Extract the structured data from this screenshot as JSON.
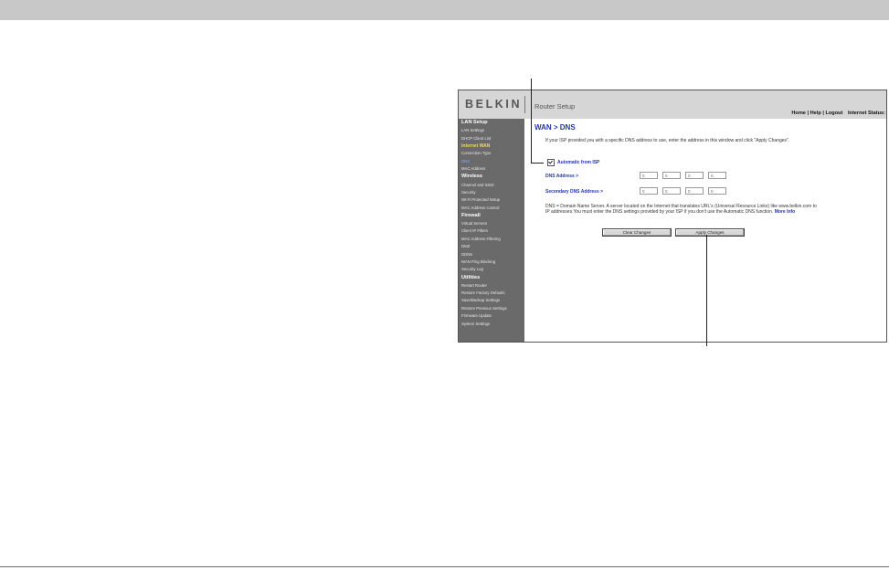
{
  "header": {
    "logo": "BELKIN",
    "title": "Router Setup",
    "links": [
      "Home",
      "Help",
      "Logout"
    ],
    "internet_status_label": "Internet Status:"
  },
  "sidebar": {
    "items": [
      {
        "label": "LAN Setup",
        "type": "heading"
      },
      {
        "label": "LAN Settings",
        "type": "link"
      },
      {
        "label": "DHCP Client List",
        "type": "link"
      },
      {
        "label": "Internet WAN",
        "type": "active-heading"
      },
      {
        "label": "Connection Type",
        "type": "link"
      },
      {
        "label": "DNS",
        "type": "current"
      },
      {
        "label": "MAC Address",
        "type": "link"
      },
      {
        "label": "Wireless",
        "type": "heading"
      },
      {
        "label": "Channel and SSID",
        "type": "link"
      },
      {
        "label": "Security",
        "type": "link"
      },
      {
        "label": "Wi-Fi Protected Setup",
        "type": "link"
      },
      {
        "label": "MAC Address Control",
        "type": "link"
      },
      {
        "label": "Firewall",
        "type": "heading"
      },
      {
        "label": "Virtual Servers",
        "type": "link"
      },
      {
        "label": "Client IP Filters",
        "type": "link"
      },
      {
        "label": "MAC Address Filtering",
        "type": "link"
      },
      {
        "label": "DMZ",
        "type": "link"
      },
      {
        "label": "DDNS",
        "type": "link"
      },
      {
        "label": "WAN Ping Blocking",
        "type": "link"
      },
      {
        "label": "Security Log",
        "type": "link"
      },
      {
        "label": "Utilities",
        "type": "heading"
      },
      {
        "label": "Restart Router",
        "type": "link"
      },
      {
        "label": "Restore Factory Defaults",
        "type": "link"
      },
      {
        "label": "Save/Backup Settings",
        "type": "link"
      },
      {
        "label": "Restore Previous Settings",
        "type": "link"
      },
      {
        "label": "Firmware Update",
        "type": "link"
      },
      {
        "label": "System Settings",
        "type": "link"
      }
    ]
  },
  "main": {
    "breadcrumb": "WAN > DNS",
    "intro": "If your ISP provided you with a specific DNS address to use, enter the address in this window and click \"Apply Changes\".",
    "automatic_label": "Automatic from ISP",
    "automatic_checked": true,
    "dns_label": "DNS Address >",
    "dns_octets": [
      "0",
      "0",
      "0",
      "0"
    ],
    "secondary_label": "Secondary DNS Address >",
    "secondary_octets": [
      "0",
      "0",
      "0",
      "0"
    ],
    "description": "DNS = Domain Name Server. A server located on the Internet that translates URL's (Universal Resource Links) like www.belkin.com to IP addresses.You must enter the DNS settings provided by your ISP if you don't use the Automatic DNS function.",
    "more_info": "More Info",
    "clear_button": "Clear Changes",
    "apply_button": "Apply Changes"
  },
  "colors": {
    "page_bar": "#c8c8c8",
    "sidebar_bg": "#6a6a6a",
    "heading_blue": "#2436a8",
    "active_yellow": "#f2d76a"
  }
}
